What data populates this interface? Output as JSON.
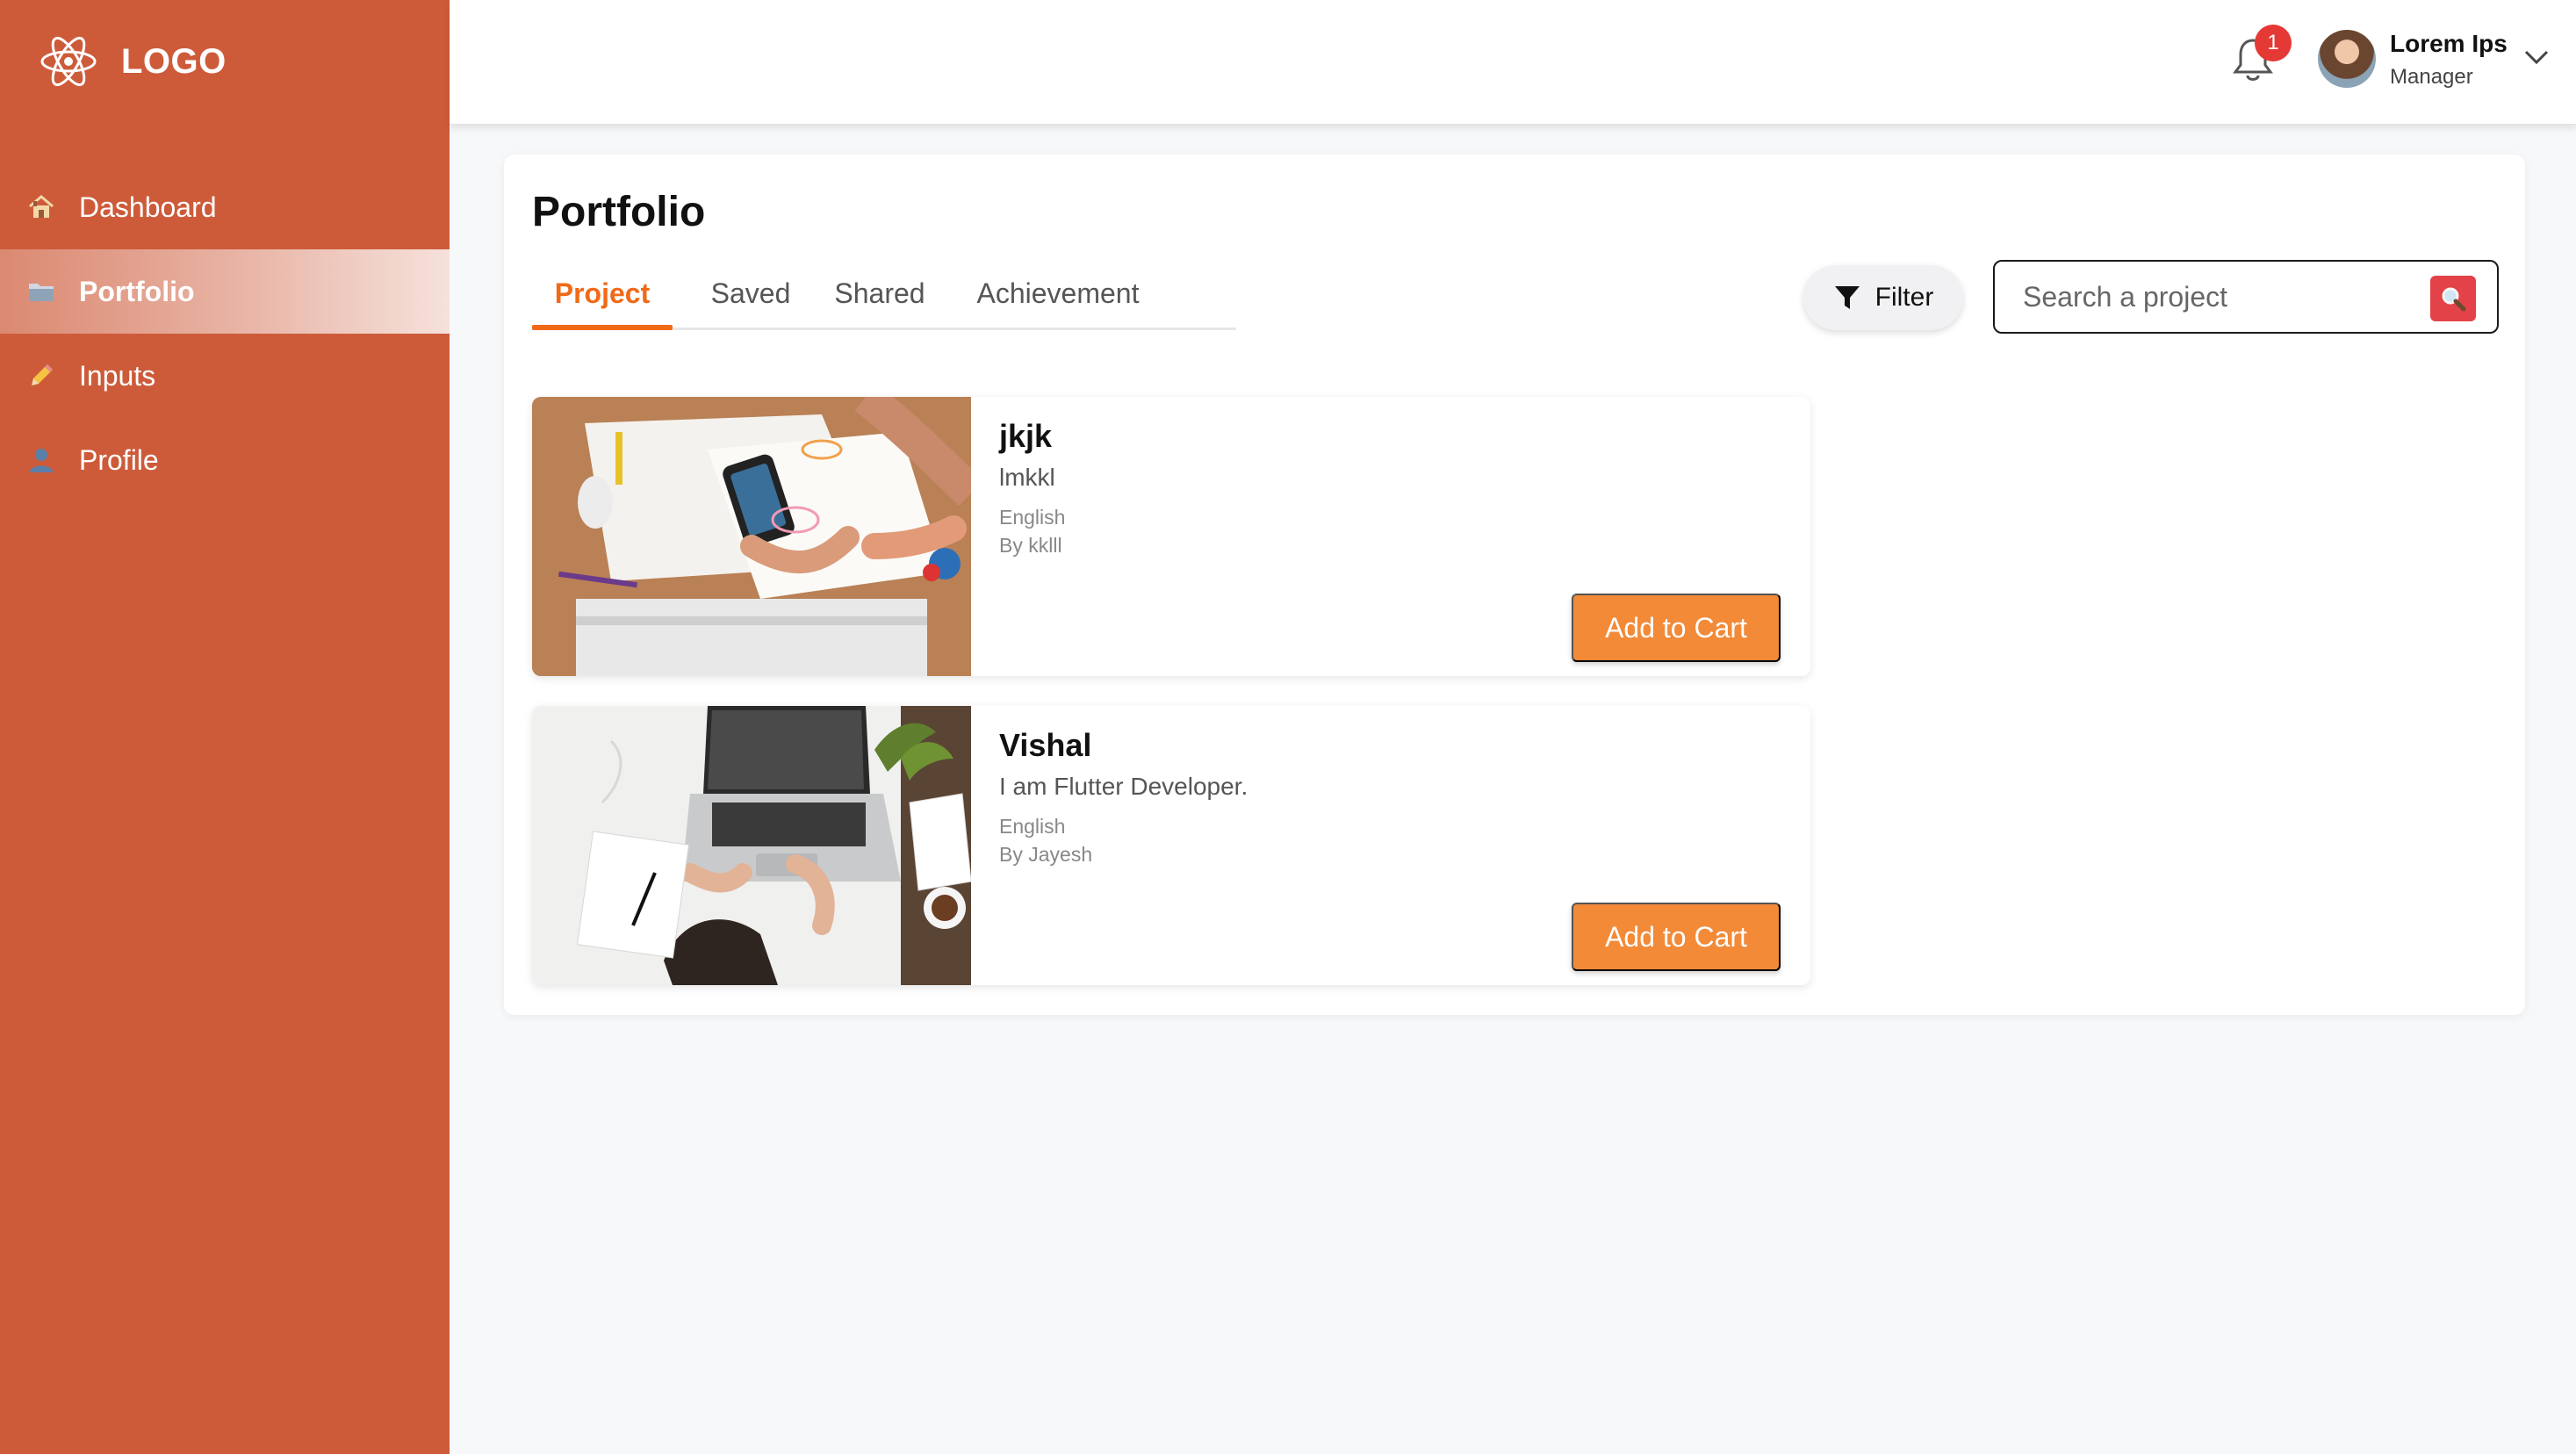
{
  "sidebar": {
    "brand": "LOGO",
    "items": [
      {
        "label": "Dashboard",
        "icon": "house-icon"
      },
      {
        "label": "Portfolio",
        "icon": "folder-icon",
        "active": true
      },
      {
        "label": "Inputs",
        "icon": "pencil-icon"
      },
      {
        "label": "Profile",
        "icon": "user-icon"
      }
    ],
    "background": "#cd5b3a"
  },
  "header": {
    "notification_count": "1",
    "user_name": "Lorem Ips",
    "user_role": "Manager"
  },
  "main": {
    "title": "Portfolio",
    "tabs": [
      {
        "label": "Project",
        "active": true
      },
      {
        "label": "Saved"
      },
      {
        "label": "Shared"
      },
      {
        "label": "Achievement"
      }
    ],
    "filter_label": "Filter",
    "search": {
      "placeholder": "Search a project",
      "value": ""
    },
    "accent": "#f06a17",
    "cards": [
      {
        "title": "jkjk",
        "description": "lmkkl",
        "language": "English",
        "author": "By kklll",
        "button": "Add to Cart"
      },
      {
        "title": "Vishal",
        "description": "I am Flutter Developer.",
        "language": "English",
        "author": "By Jayesh",
        "button": "Add to Cart"
      }
    ]
  }
}
